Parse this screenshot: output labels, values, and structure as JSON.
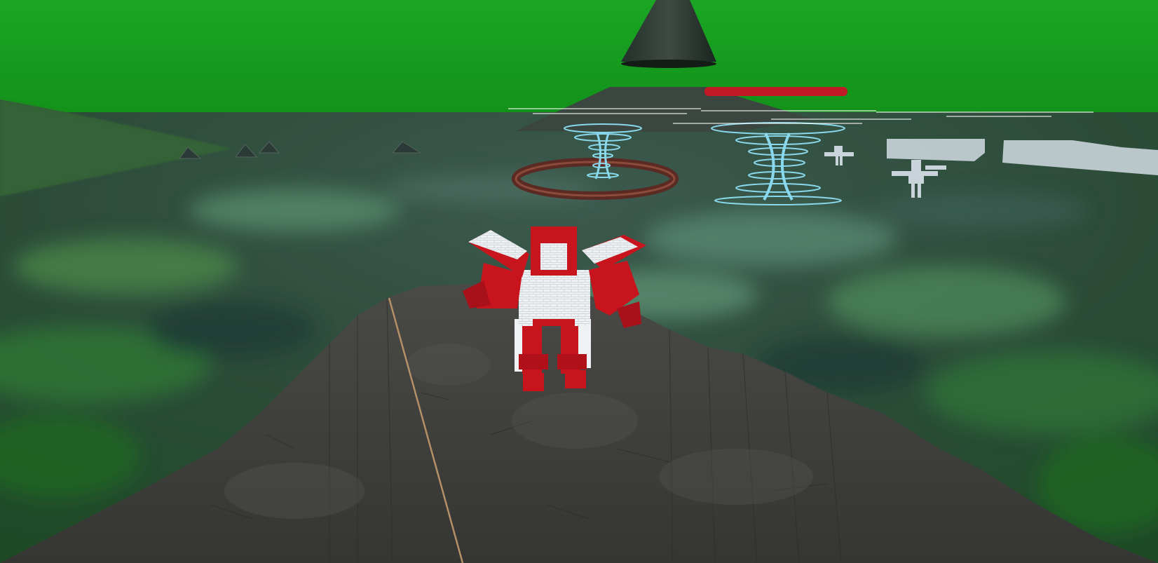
{
  "scene": {
    "sky_color": "#17a31f",
    "sea_color": "#2c4a3c",
    "rock_color": "#3f3f3c",
    "robot_primary": "#c8141c",
    "robot_secondary": "#e9eef0",
    "tornado_color": "#7fd6ee"
  },
  "objects": {
    "player": "red-white-robot",
    "spire": "dark-stone-spire",
    "ring": "stone-ring-portal",
    "tornadoes": [
      "water-tornado",
      "water-tornado"
    ],
    "enemies": [
      "white-robot",
      "white-robot"
    ],
    "health_bar_fill": 1.0
  }
}
